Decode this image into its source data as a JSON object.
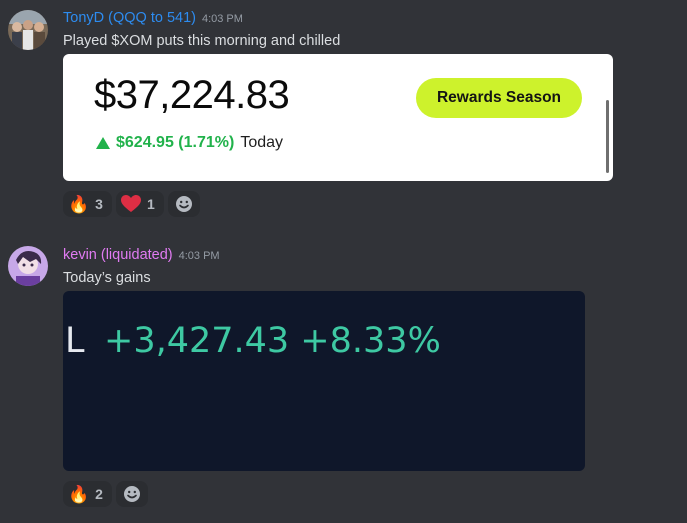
{
  "messages": [
    {
      "username": "TonyD (QQQ to 541)",
      "username_color": "#2d8cf0",
      "timestamp": "4:03 PM",
      "text": "Played $XOM puts this morning and chilled",
      "embed": {
        "portfolio_value": "$37,224.83",
        "change": "$624.95 (1.71%)",
        "change_period": "Today",
        "button_label": "Rewards Season",
        "up_color": "#21b24b",
        "button_color": "#cdf22c"
      },
      "reactions": [
        {
          "emoji": "fire-icon",
          "glyph": "🔥",
          "count": "3"
        },
        {
          "emoji": "heart-icon",
          "glyph": "❤",
          "count": "1"
        }
      ]
    },
    {
      "username": "kevin (liquidated)",
      "username_color": "#e07bf2",
      "timestamp": "4:03 PM",
      "text": "Today’s gains",
      "embed": {
        "label": "L",
        "gain": "+3,427.43 +8.33%",
        "gain_color": "#3ec9a3",
        "background": "#0f172a"
      },
      "reactions": [
        {
          "emoji": "fire-icon",
          "glyph": "🔥",
          "count": "2"
        }
      ]
    }
  ]
}
